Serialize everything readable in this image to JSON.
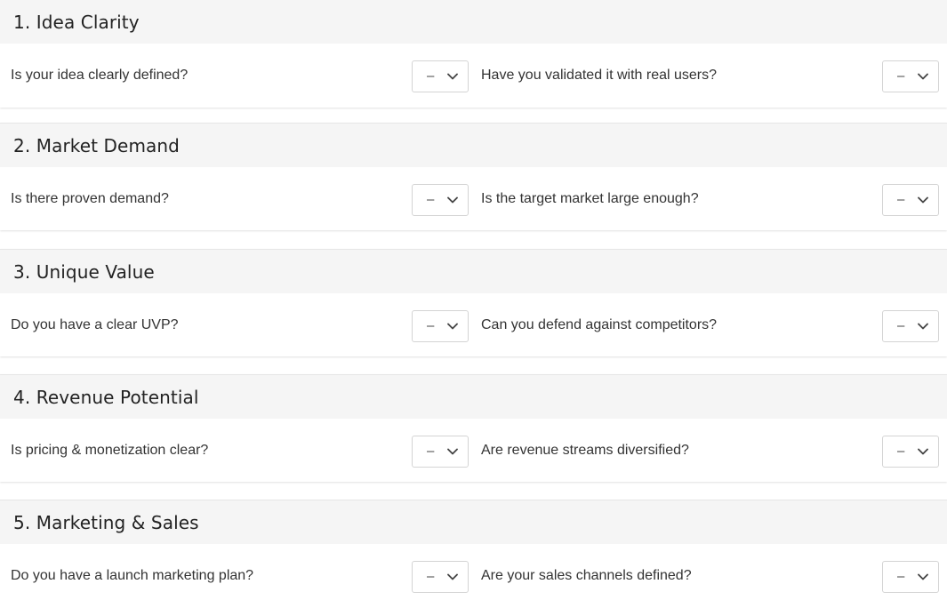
{
  "sections": [
    {
      "title": "1. Idea Clarity",
      "questions": [
        {
          "label": "Is your idea clearly defined?",
          "value": "–"
        },
        {
          "label": "Have you validated it with real users?",
          "value": "–"
        }
      ]
    },
    {
      "title": "2. Market Demand",
      "questions": [
        {
          "label": "Is there proven demand?",
          "value": "–"
        },
        {
          "label": "Is the target market large enough?",
          "value": "–"
        }
      ]
    },
    {
      "title": "3. Unique Value",
      "questions": [
        {
          "label": "Do you have a clear UVP?",
          "value": "–"
        },
        {
          "label": "Can you defend against competitors?",
          "value": "–"
        }
      ]
    },
    {
      "title": "4. Revenue Potential",
      "questions": [
        {
          "label": "Is pricing & monetization clear?",
          "value": "–"
        },
        {
          "label": "Are revenue streams diversified?",
          "value": "–"
        }
      ]
    },
    {
      "title": "5. Marketing & Sales",
      "questions": [
        {
          "label": "Do you have a launch marketing plan?",
          "value": "–"
        },
        {
          "label": "Are your sales channels defined?",
          "value": "–"
        }
      ]
    }
  ],
  "icons": {
    "select_arrow": "chevron-down-icon"
  },
  "colors": {
    "header_bg": "#f5f5f5",
    "body_bg": "#ffffff",
    "border": "#d4d4d4",
    "text": "#333333"
  }
}
